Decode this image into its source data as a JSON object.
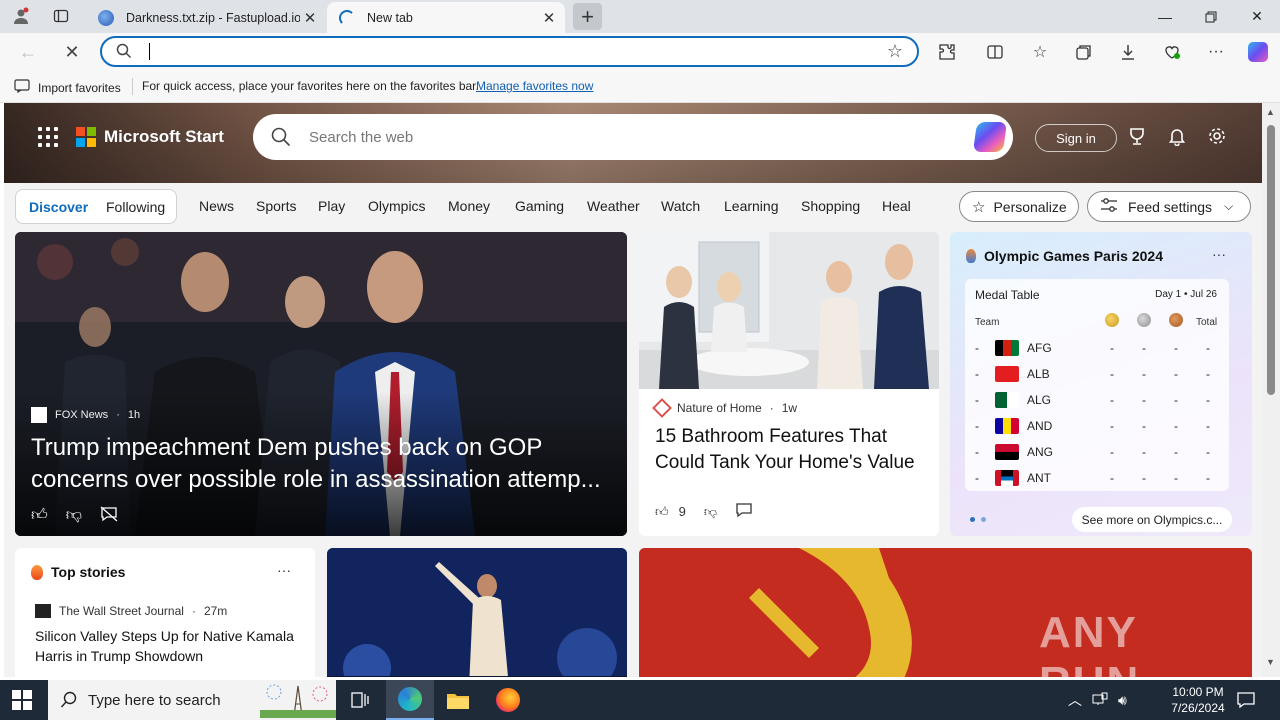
{
  "browser": {
    "tabs": [
      {
        "title": "Darkness.txt.zip - Fastupload.io",
        "active": false
      },
      {
        "title": "New tab",
        "active": true
      }
    ],
    "address": {
      "value": "",
      "placeholder": ""
    },
    "favorites_bar": {
      "import_label": "Import favorites",
      "message": "For quick access, place your favorites here on the favorites bar.",
      "manage_link": "Manage favorites now"
    }
  },
  "page": {
    "brand": "Microsoft Start",
    "search_placeholder": "Search the web",
    "sign_in": "Sign in",
    "feed_tabs": {
      "discover": "Discover",
      "following": "Following"
    },
    "nav": [
      "News",
      "Sports",
      "Play",
      "Olympics",
      "Money",
      "Gaming",
      "Weather",
      "Watch",
      "Learning",
      "Shopping",
      "Heal"
    ],
    "personalize": "Personalize",
    "feed_settings": "Feed settings",
    "main_story": {
      "source": "FOX News",
      "age": "1h",
      "headline": "Trump impeachment Dem pushes back on GOP concerns over possible role in assassination attemp..."
    },
    "second_story": {
      "source": "Nature of Home",
      "age": "1w",
      "headline": "15 Bathroom Features That Could Tank Your Home's Value",
      "likes": "9"
    },
    "olympics": {
      "title": "Olympic Games Paris 2024",
      "medal_table_label": "Medal Table",
      "day": "Day 1 • Jul 26",
      "team_header": "Team",
      "total_header": "Total",
      "rows": [
        {
          "rank": "-",
          "code": "AFG",
          "gold": "-",
          "silver": "-",
          "bronze": "-",
          "total": "-"
        },
        {
          "rank": "-",
          "code": "ALB",
          "gold": "-",
          "silver": "-",
          "bronze": "-",
          "total": "-"
        },
        {
          "rank": "-",
          "code": "ALG",
          "gold": "-",
          "silver": "-",
          "bronze": "-",
          "total": "-"
        },
        {
          "rank": "-",
          "code": "AND",
          "gold": "-",
          "silver": "-",
          "bronze": "-",
          "total": "-"
        },
        {
          "rank": "-",
          "code": "ANG",
          "gold": "-",
          "silver": "-",
          "bronze": "-",
          "total": "-"
        },
        {
          "rank": "-",
          "code": "ANT",
          "gold": "-",
          "silver": "-",
          "bronze": "-",
          "total": "-"
        }
      ],
      "see_more": "See more on Olympics.c..."
    },
    "top_stories": {
      "title": "Top stories",
      "source": "The Wall Street Journal",
      "age": "27m",
      "headline": "Silicon Valley Steps Up for Native Kamala Harris in Trump Showdown"
    },
    "watermark": "ANY RUN"
  },
  "taskbar": {
    "search_placeholder": "Type here to search",
    "time": "10:00 PM",
    "date": "7/26/2024"
  },
  "colors": {
    "accent": "#0f6cbd",
    "taskbar": "#1f2a38",
    "link": "#0f5fb3"
  }
}
